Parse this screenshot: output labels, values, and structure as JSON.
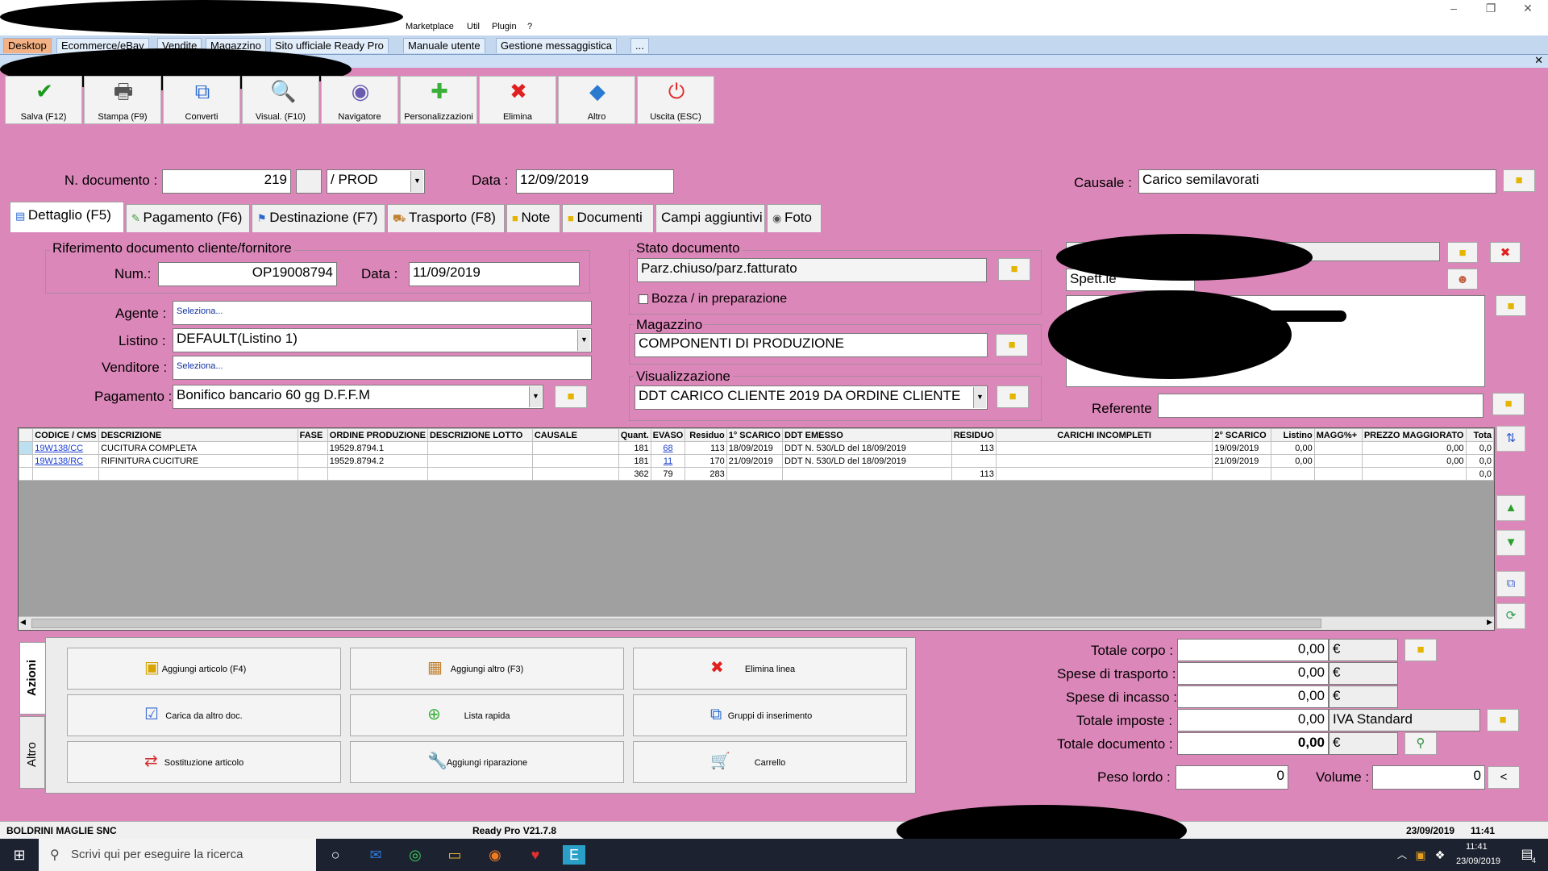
{
  "menu": [
    "Marketplace",
    "Util",
    "Plugin",
    "?"
  ],
  "tabs": [
    "Desktop",
    "Ecommerce/eBay",
    "Vendite",
    "Magazzino",
    "Sito ufficiale Ready Pro",
    "Manuale utente",
    "Gestione messaggistica",
    "..."
  ],
  "toolbar": [
    {
      "label": "Salva (F12)",
      "icon": "checkmark-icon",
      "glyph": "✔",
      "color": "#1a9a1a"
    },
    {
      "label": "Stampa (F9)",
      "icon": "printer-icon",
      "glyph": "🖶",
      "color": "#555"
    },
    {
      "label": "Converti",
      "icon": "convert-icon",
      "glyph": "⧉",
      "color": "#2a6ad0"
    },
    {
      "label": "Visual. (F10)",
      "icon": "magnifier-icon",
      "glyph": "🔍",
      "color": "#444"
    },
    {
      "label": "Navigatore",
      "icon": "navigator-icon",
      "glyph": "◉",
      "color": "#6a5ab0"
    },
    {
      "label": "Personalizzazioni",
      "icon": "puzzle-icon",
      "glyph": "✚",
      "color": "#3ab03a"
    },
    {
      "label": "Elimina",
      "icon": "delete-x-icon",
      "glyph": "✖",
      "color": "#e02020"
    },
    {
      "label": "Altro",
      "icon": "other-icon",
      "glyph": "◆",
      "color": "#2a7ad0"
    },
    {
      "label": "Uscita (ESC)",
      "icon": "exit-icon",
      "glyph": "⏻",
      "color": "#e03030"
    }
  ],
  "header": {
    "n_doc_label": "N. documento :",
    "n_doc_value": "219",
    "series": "/ PROD",
    "data_label": "Data :",
    "data_value": "12/09/2019",
    "causale_label": "Causale :",
    "causale_value": "Carico semilavorati"
  },
  "detail_tabs": [
    "Dettaglio (F5)",
    "Pagamento (F6)",
    "Destinazione (F7)",
    "Trasporto (F8)",
    "Note",
    "Documenti",
    "Campi aggiuntivi",
    "Foto"
  ],
  "riferimento": {
    "title": "Riferimento documento cliente/fornitore",
    "num_label": "Num.:",
    "num_value": "OP19008794",
    "data_label": "Data :",
    "data_value": "11/09/2019"
  },
  "left_fields": {
    "agente_label": "Agente :",
    "agente_value": "Seleziona...",
    "listino_label": "Listino :",
    "listino_value": "DEFAULT(Listino 1)",
    "venditore_label": "Venditore :",
    "venditore_value": "Seleziona...",
    "pagamento_label": "Pagamento :",
    "pagamento_value": "Bonifico bancario 60 gg D.F.F.M"
  },
  "stato": {
    "title": "Stato documento",
    "value": "Parz.chiuso/parz.fatturato",
    "bozza": "Bozza / in preparazione"
  },
  "magazzino": {
    "title": "Magazzino",
    "value": "COMPONENTI  DI PRODUZIONE"
  },
  "visualizzazione": {
    "title": "Visualizzazione",
    "value": "DDT CARICO CLIENTE 2019 DA ORDINE CLIENTE"
  },
  "cliente": {
    "spett": "Spett.le",
    "referente_label": "Referente"
  },
  "grid": {
    "columns": [
      "CODICE / CMS",
      "DESCRIZIONE",
      "FASE",
      "ORDINE PRODUZIONE",
      "DESCRIZIONE LOTTO",
      "CAUSALE",
      "Quant.",
      "EVASO",
      "Residuo",
      "1° SCARICO",
      "DDT EMESSO",
      "RESIDUO",
      "CARICHI INCOMPLETI",
      "2° SCARICO",
      "Listino",
      "MAGG%+",
      "PREZZO MAGGIORATO",
      "Tota"
    ],
    "rows": [
      [
        "19W138/CC",
        "CUCITURA COMPLETA",
        "",
        "19529.8794.1",
        "",
        "",
        "181",
        "68",
        "113",
        "18/09/2019",
        "DDT N. 530/LD del 18/09/2019",
        "113",
        "",
        "19/09/2019",
        "0,00",
        "",
        "0,00",
        "0,0"
      ],
      [
        "19W138/RC",
        "RIFINITURA CUCITURE",
        "",
        "19529.8794.2",
        "",
        "",
        "181",
        "11",
        "170",
        "21/09/2019",
        "DDT N. 530/LD del 18/09/2019",
        "",
        "",
        "21/09/2019",
        "0,00",
        "",
        "0,00",
        "0,0"
      ],
      [
        "",
        "",
        "",
        "",
        "",
        "",
        "362",
        "79",
        "283",
        "",
        "",
        "113",
        "",
        "",
        "",
        "",
        "",
        "0,0"
      ]
    ]
  },
  "actions_tabs": [
    "Azioni",
    "Altro"
  ],
  "actions": [
    {
      "label": "Aggiungi articolo (F4)",
      "icon": "box-add-icon",
      "glyph": "▣",
      "color": "#d8a400"
    },
    {
      "label": "Aggiungi altro (F3)",
      "icon": "table-add-icon",
      "glyph": "▦",
      "color": "#c08030"
    },
    {
      "label": "Elimina linea",
      "icon": "delete-x-icon",
      "glyph": "✖",
      "color": "#e02020"
    },
    {
      "label": "Carica da altro doc.",
      "icon": "load-doc-icon",
      "glyph": "☑",
      "color": "#3a6ad0"
    },
    {
      "label": "Lista rapida",
      "icon": "quick-list-icon",
      "glyph": "⊕",
      "color": "#3ab03a"
    },
    {
      "label": "Gruppi di inserimento",
      "icon": "groups-icon",
      "glyph": "⧉",
      "color": "#2a6ad0"
    },
    {
      "label": "Sostituzione articolo",
      "icon": "replace-icon",
      "glyph": "⇄",
      "color": "#d03030"
    },
    {
      "label": "Aggiungi riparazione",
      "icon": "wrench-icon",
      "glyph": "🔧",
      "color": "#777"
    },
    {
      "label": "Carrello",
      "icon": "cart-icon",
      "glyph": "🛒",
      "color": "#777"
    }
  ],
  "totals": {
    "corpo_label": "Totale corpo :",
    "corpo_value": "0,00",
    "trasporto_label": "Spese di trasporto :",
    "trasporto_value": "0,00",
    "incasso_label": "Spese di incasso :",
    "incasso_value": "0,00",
    "imposte_label": "Totale imposte :",
    "imposte_value": "0,00",
    "iva": "IVA Standard",
    "documento_label": "Totale documento :",
    "documento_value": "0,00",
    "currency": "€",
    "peso_label": "Peso lordo :",
    "peso_value": "0",
    "volume_label": "Volume :",
    "volume_value": "0",
    "less": "<"
  },
  "status": {
    "company": "BOLDRINI MAGLIE SNC",
    "version": "Ready Pro V21.7.8",
    "date": "23/09/2019",
    "time": "11:41"
  },
  "taskbar": {
    "search": "Scrivi qui per eseguire la ricerca",
    "time": "11:41",
    "date": "23/09/2019",
    "notif": "4"
  }
}
